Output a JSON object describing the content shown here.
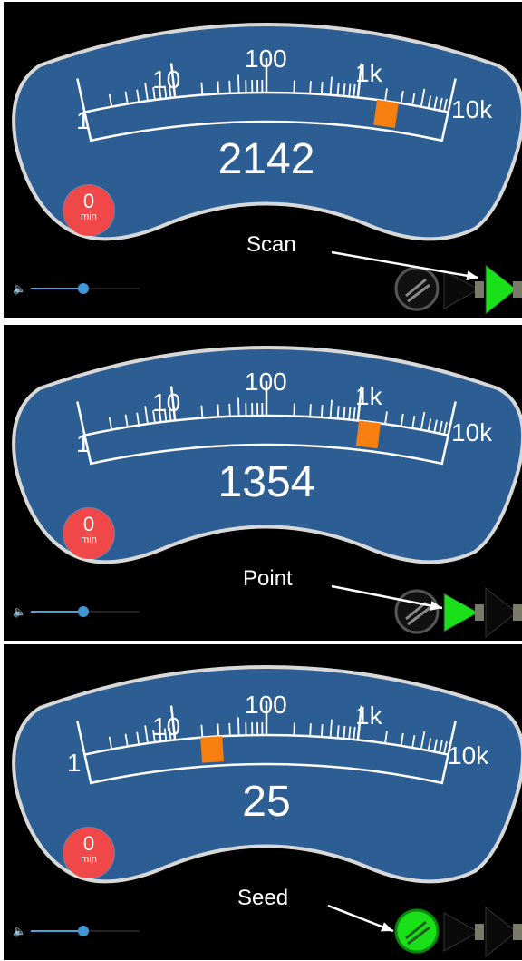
{
  "panels": [
    {
      "readout": "2142",
      "scale_labels": [
        "1",
        "10",
        "100",
        "1k",
        "10k"
      ],
      "timer": {
        "value": "0",
        "unit": "min"
      },
      "caption": "Scan",
      "active_mode": "scan",
      "indicator_value": 2142
    },
    {
      "readout": "1354",
      "scale_labels": [
        "1",
        "10",
        "100",
        "1k",
        "10k"
      ],
      "timer": {
        "value": "0",
        "unit": "min"
      },
      "caption": "Point",
      "active_mode": "point",
      "indicator_value": 1354
    },
    {
      "readout": "25",
      "scale_labels": [
        "1",
        "10",
        "100",
        "1k",
        "10k"
      ],
      "timer": {
        "value": "0",
        "unit": "min"
      },
      "caption": "Seed",
      "active_mode": "seed",
      "indicator_value": 25
    }
  ],
  "icons": {
    "volume": "speaker-icon",
    "seed": "seed-mode-icon",
    "point": "point-mode-icon",
    "scan": "scan-mode-icon"
  },
  "colors": {
    "gauge_face": "#2c5e94",
    "indicator": "#f77f10",
    "timer": "#f04848",
    "active_mode": "#19e019",
    "volume_slider": "#3f97d6"
  }
}
